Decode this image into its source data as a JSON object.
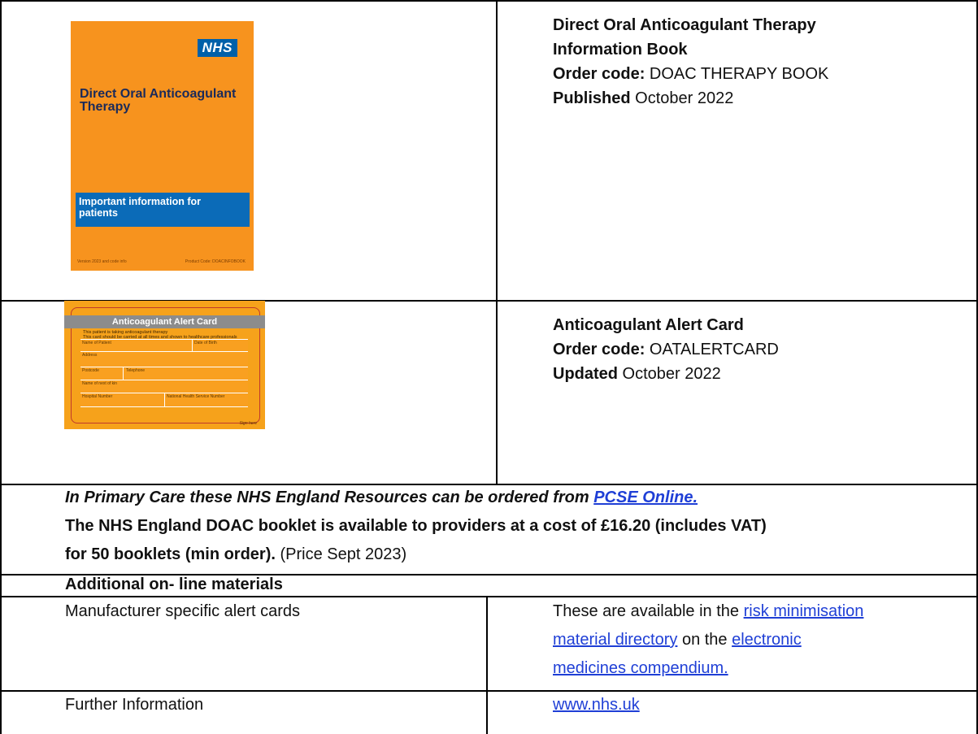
{
  "row1": {
    "cover": {
      "logo": "NHS",
      "title": "Direct Oral Anticoagulant Therapy",
      "band_text": "Important information for patients",
      "footer_left": "Version 2023 and code info",
      "footer_right": "Product Code: DOACINFOBOOK"
    },
    "title_line1": "Direct Oral Anticoagulant Therapy",
    "title_line2": "Information Book",
    "order_label": "Order code:",
    "order_value": " DOAC THERAPY BOOK",
    "published_label": "Published",
    "published_value": " October 2022"
  },
  "row2": {
    "card": {
      "heading": "Anticoagulant Alert Card",
      "intro1": "This patient is taking anticoagulant therapy",
      "intro2": "This card should be carried at all times and shown to healthcare professionals",
      "f_name": "Name of Patient",
      "f_dob": "Date of Birth",
      "f_address": "Address",
      "f_postcode": "Postcode",
      "f_telephone": "Telephone",
      "f_nok": "Name of next of kin",
      "f_hospital": "Hospital Number",
      "f_nhs": "National Health Service Number",
      "signature": "Sign here"
    },
    "title": "Anticoagulant Alert Card",
    "order_label": "Order code:",
    "order_value": " OATALERTCARD",
    "updated_label": "Updated",
    "updated_value": " October 2022"
  },
  "row3": {
    "line1_text": "In Primary Care these NHS England Resources can be ordered from ",
    "line1_link": "PCSE Online.",
    "line2": "The NHS England DOAC booklet is available to providers at a cost of £16.20 (includes VAT)",
    "line3_bold": "for 50 booklets (min order).",
    "line3_normal": " (Price Sept 2023)"
  },
  "row4": {
    "heading": "Additional on- line materials"
  },
  "row5": {
    "left": "Manufacturer specific alert cards",
    "right_pre": "These are available in the ",
    "link1_part1": "risk minimisation",
    "link1_part2": "material directory",
    "right_mid": " on the ",
    "link2_part1": "electronic",
    "link2_part2": "medicines compendium."
  },
  "row6": {
    "left": "Further Information",
    "right_link": "www.nhs.uk"
  }
}
